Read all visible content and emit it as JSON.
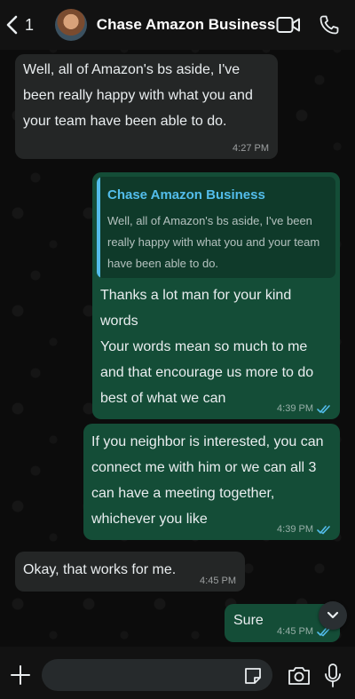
{
  "header": {
    "back_count": "1",
    "contact_name": "Chase Amazon Business",
    "icons": [
      "chevron-left-icon",
      "video-call-icon",
      "phone-call-icon"
    ]
  },
  "messages": [
    {
      "direction": "incoming",
      "text": "Well, all of Amazon's bs aside, I've been really happy with what you and your team have been able to do.",
      "time": "4:27 PM"
    },
    {
      "direction": "outgoing",
      "quote": {
        "author": "Chase Amazon Business",
        "text": "Well, all of Amazon's bs aside, I've been really happy with what you and your team have been able to do."
      },
      "text": "Thanks a lot man for your kind words\nYour words mean so much to me and that encourage us more to do best of what we can",
      "time": "4:39 PM",
      "status": "read"
    },
    {
      "direction": "outgoing",
      "text": "If you neighbor is interested, you can connect me with him or we can all 3 can have a meeting together, whichever you like",
      "time": "4:39 PM",
      "status": "read"
    },
    {
      "direction": "incoming",
      "text": "Okay, that works for me.",
      "time": "4:45 PM"
    },
    {
      "direction": "outgoing",
      "text": "Sure",
      "time": "4:45 PM",
      "status": "read"
    }
  ],
  "composer": {
    "placeholder": "",
    "icons": [
      "plus-icon",
      "sticker-icon",
      "camera-icon",
      "microphone-icon"
    ]
  },
  "colors": {
    "incoming_bubble": "#242626",
    "outgoing_bubble": "#144d37",
    "read_ticks": "#53bdeb",
    "quote_accent": "#53bdeb"
  }
}
